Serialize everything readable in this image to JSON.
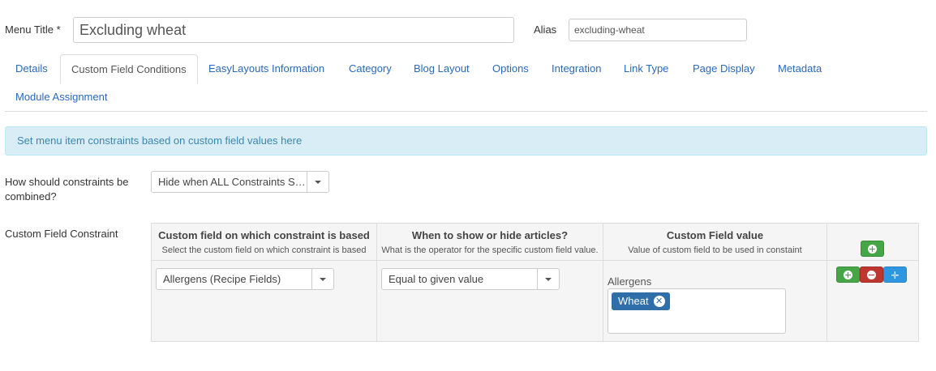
{
  "header": {
    "menu_title_label": "Menu Title *",
    "menu_title_value": "Excluding wheat",
    "alias_label": "Alias",
    "alias_value": "excluding-wheat"
  },
  "tabs": [
    {
      "label": "Details",
      "active": false
    },
    {
      "label": "Custom Field Conditions",
      "active": true
    },
    {
      "label": "EasyLayouts Information",
      "active": false
    },
    {
      "label": "Category",
      "active": false
    },
    {
      "label": "Blog Layout",
      "active": false
    },
    {
      "label": "Options",
      "active": false
    },
    {
      "label": "Integration",
      "active": false
    },
    {
      "label": "Link Type",
      "active": false
    },
    {
      "label": "Page Display",
      "active": false
    },
    {
      "label": "Metadata",
      "active": false
    },
    {
      "label": "Module Assignment",
      "active": false
    }
  ],
  "info_message": "Set menu item constraints based on custom field values here",
  "combine": {
    "label": "How should constraints be combined?",
    "selected": "Hide when ALL Constraints S…"
  },
  "constraint": {
    "label": "Custom Field Constraint",
    "columns": [
      {
        "title": "Custom field on which constraint is based",
        "subtitle": "Select the custom field on which constraint is based"
      },
      {
        "title": "When to show or hide articles?",
        "subtitle": "What is the operator for the specific custom field value."
      },
      {
        "title": "Custom Field value",
        "subtitle": "Value of custom field to be used in constaint"
      }
    ],
    "row": {
      "field_selected": "Allergens (Recipe Fields)",
      "operator_selected": "Equal to given value",
      "value_label": "Allergens",
      "value_tags": [
        "Wheat"
      ]
    }
  },
  "icons": {
    "add": "plus-circle-icon",
    "remove": "minus-circle-icon",
    "move": "move-icon",
    "tag_remove": "remove-circle-icon",
    "dropdown": "caret-down-icon"
  },
  "colors": {
    "link": "#2a69b8",
    "info_bg": "#d9edf7",
    "info_text": "#3a87ad",
    "chip": "#2f6ea8",
    "green": "#46a546",
    "red": "#bd362f",
    "blue": "#2f96e0"
  }
}
